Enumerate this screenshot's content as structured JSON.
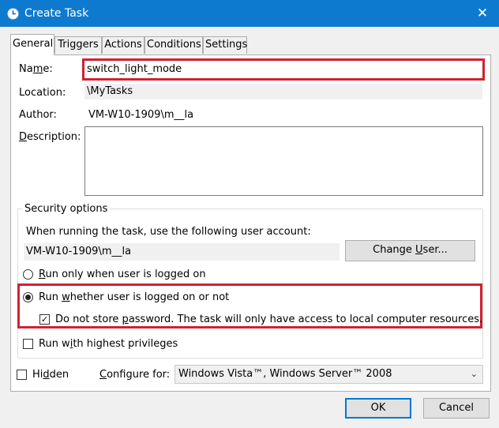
{
  "window": {
    "title": "Create Task",
    "close_glyph": "✕"
  },
  "tabs": [
    {
      "label": "General"
    },
    {
      "label": "Triggers"
    },
    {
      "label": "Actions"
    },
    {
      "label": "Conditions"
    },
    {
      "label": "Settings"
    }
  ],
  "general": {
    "name_label_pre": "Na",
    "name_label_acc": "m",
    "name_label_post": "e:",
    "name_value": "switch_light_mode",
    "location_label": "Location:",
    "location_value": "\\MyTasks",
    "author_label": "Author:",
    "author_value": "VM-W10-1909\\m__la",
    "description_label_acc": "D",
    "description_label_post": "escription:",
    "description_value": ""
  },
  "security": {
    "legend": "Security options",
    "account_prompt": "When running the task, use the following user account:",
    "account_value": "VM-W10-1909\\m__la",
    "change_user_pre": "Change ",
    "change_user_acc": "U",
    "change_user_post": "ser...",
    "radio_logged_on": {
      "acc": "R",
      "rest": "un only when user is logged on",
      "checked": false
    },
    "radio_whether": {
      "pre": "Run ",
      "acc": "w",
      "rest": "hether user is logged on or not",
      "checked": true
    },
    "do_not_store": {
      "pre": "Do not store ",
      "acc": "p",
      "rest": "assword.  The task will only have access to local computer resources.",
      "checked": true
    },
    "highest_priv": {
      "pre": "Run w",
      "acc": "i",
      "rest": "th highest privileges",
      "checked": false
    }
  },
  "bottom": {
    "hidden": {
      "pre": "Hi",
      "acc": "d",
      "rest": "den",
      "checked": false
    },
    "configure_label_acc": "C",
    "configure_label_post": "onfigure for:",
    "configure_value": "Windows Vista™, Windows Server™ 2008"
  },
  "buttons": {
    "ok": "OK",
    "cancel": "Cancel"
  },
  "colors": {
    "titlebar": "#0e7acf",
    "highlight": "#d22132",
    "default_button_border": "#0078d7"
  },
  "icons": {
    "app": "clock-icon",
    "close": "close-icon",
    "combo": "chevron-down-icon",
    "check": "checkmark-icon"
  }
}
